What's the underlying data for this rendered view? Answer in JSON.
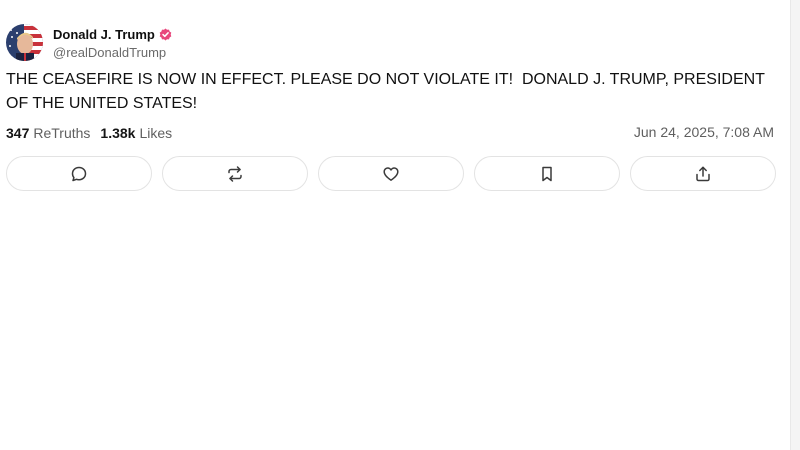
{
  "post": {
    "display_name": "Donald J. Trump",
    "handle": "@realDonaldTrump",
    "text": "THE CEASEFIRE IS NOW IN EFFECT. PLEASE DO NOT VIOLATE IT!  DONALD J. TRUMP, PRESIDENT OF THE UNITED STATES!",
    "retruths_count": "347",
    "retruths_label": "ReTruths",
    "likes_count": "1.38k",
    "likes_label": "Likes",
    "timestamp": "Jun 24, 2025, 7:08 AM"
  },
  "actions": [
    {
      "icon": "reply-icon"
    },
    {
      "icon": "retruth-icon"
    },
    {
      "icon": "like-icon"
    },
    {
      "icon": "bookmark-icon"
    },
    {
      "icon": "share-icon"
    }
  ],
  "colors": {
    "verified_badge": "#e8467c",
    "text": "#111111",
    "muted": "#5f5f5f",
    "border": "#e3e3e3"
  }
}
